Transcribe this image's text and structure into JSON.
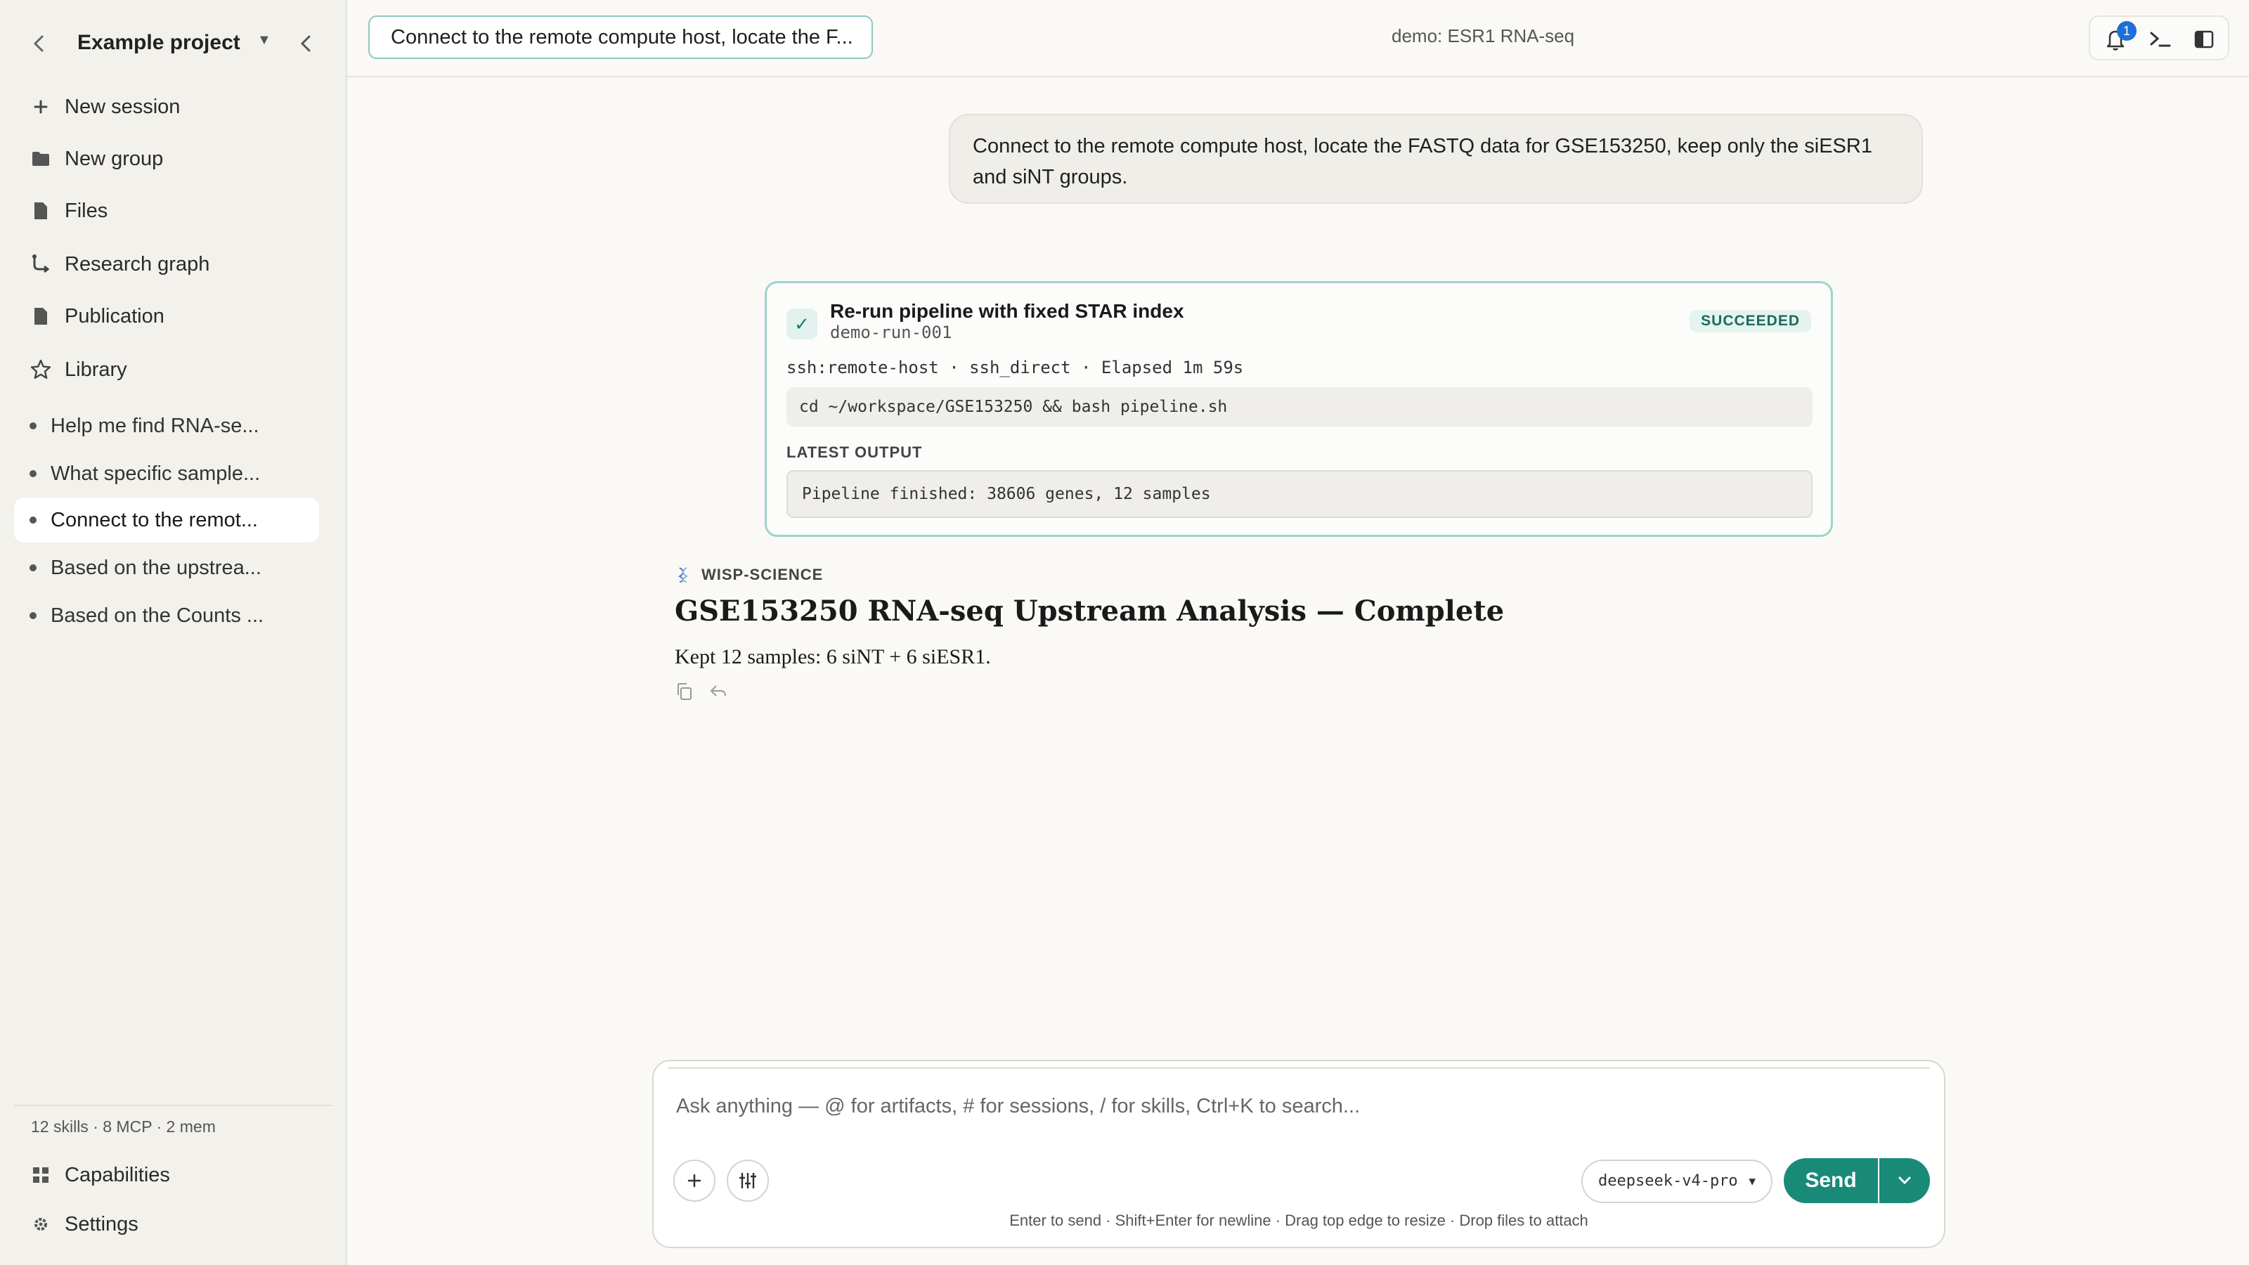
{
  "sidebar": {
    "project_title": "Example project",
    "nav": [
      {
        "label": "New session",
        "icon": "plus-icon"
      },
      {
        "label": "New group",
        "icon": "folder-icon"
      },
      {
        "label": "Files",
        "icon": "file-icon"
      },
      {
        "label": "Research graph",
        "icon": "graph-icon"
      },
      {
        "label": "Publication",
        "icon": "file-icon"
      },
      {
        "label": "Library",
        "icon": "star-icon"
      }
    ],
    "sessions": [
      {
        "label": "Help me find RNA-se..."
      },
      {
        "label": "What specific sample..."
      },
      {
        "label": "Connect to the remot...",
        "active": true
      },
      {
        "label": "Based on the upstrea..."
      },
      {
        "label": "Based on the Counts ..."
      }
    ],
    "stats": "12 skills · 8 MCP · 2 mem",
    "capabilities_label": "Capabilities",
    "settings_label": "Settings"
  },
  "header": {
    "session_title": "Connect to the remote compute host, locate the F...",
    "demo_label": "demo: ESR1 RNA-seq",
    "notification_count": "1"
  },
  "chat": {
    "user_message": "Connect to the remote compute host, locate the FASTQ data for GSE153250, keep only the siESR1 and siNT groups.",
    "run_card": {
      "title": "Re-run pipeline with fixed STAR index",
      "run_id": "demo-run-001",
      "status": "SUCCEEDED",
      "meta": "ssh:remote-host · ssh_direct · Elapsed 1m 59s",
      "command": "cd ~/workspace/GSE153250 && bash pipeline.sh",
      "output_label": "LATEST OUTPUT",
      "output": "Pipeline finished: 38606 genes, 12 samples"
    },
    "agent_name": "WISP-SCIENCE",
    "answer_title": "GSE153250 RNA-seq Upstream Analysis — Complete",
    "answer_body": "Kept 12 samples: 6 siNT + 6 siESR1."
  },
  "composer": {
    "placeholder": "Ask anything — @ for artifacts, # for sessions, / for skills, Ctrl+K to search...",
    "model": "deepseek-v4-pro",
    "send_label": "Send",
    "hint": "Enter to send · Shift+Enter for newline · Drag top edge to resize · Drop files to attach"
  },
  "colors": {
    "accent": "#1a8a78",
    "sidebar_bg": "#f2f1ec",
    "badge": "#1f6fd8"
  }
}
